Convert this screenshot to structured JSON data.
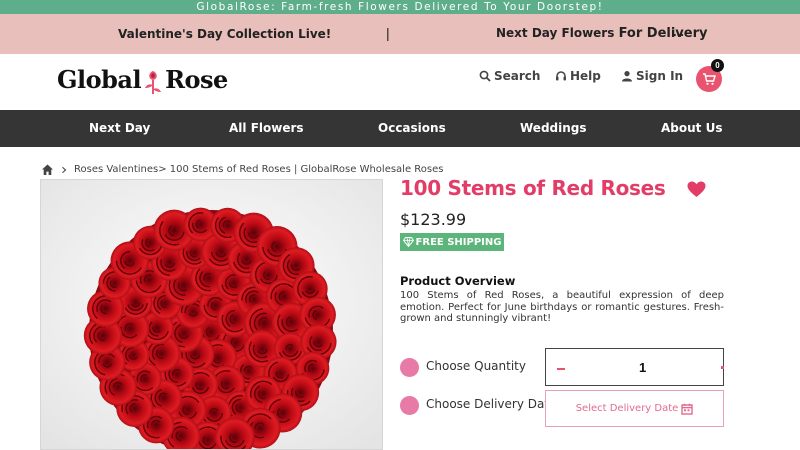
{
  "topbar": {
    "text": "GlobalRose: Farm-fresh Flowers Delivered To Your Doorstep!"
  },
  "promo": {
    "left": "Valentine's Day Collection Live!",
    "separator": "|",
    "right_prefix": "Next Day Flowers",
    "right_bold": "For Delivery",
    "more": "..."
  },
  "header": {
    "logo_part1": "Global",
    "logo_part2": "Rose",
    "search": "Search",
    "help": "Help",
    "signin": "Sign In",
    "cart_count": "0"
  },
  "nav": [
    "Next Day",
    "All Flowers",
    "Occasions",
    "Weddings",
    "About Us"
  ],
  "breadcrumb": {
    "text": "Roses Valentines> 100 Stems of Red Roses | GlobalRose Wholesale Roses"
  },
  "product": {
    "title": "100 Stems of Red Roses",
    "price": "$123.99",
    "shipping_badge": "FREE SHIPPING",
    "overview_title": "Product Overview",
    "overview_text": "100 Stems of Red Roses, a beautiful expression of deep emotion. Perfect for June birthdays or romantic gestures. Fresh-grown and stunningly vibrant!",
    "quantity_label": "Choose Quantity",
    "quantity_value": "1",
    "delivery_label": "Choose Delivery Date",
    "delivery_button": "Select Delivery Date"
  },
  "icons": {
    "home": "home-icon",
    "search": "search-icon",
    "help": "headset-icon",
    "user": "user-icon",
    "cart": "cart-icon",
    "heart": "heart-icon",
    "diamond": "diamond-icon",
    "calendar": "calendar-icon"
  },
  "colors": {
    "topbar": "#5fae8b",
    "promo": "#e8bfba",
    "nav": "#353535",
    "accent": "#e23d66",
    "shipping": "#5cb57a",
    "dot": "#e77aa6"
  }
}
